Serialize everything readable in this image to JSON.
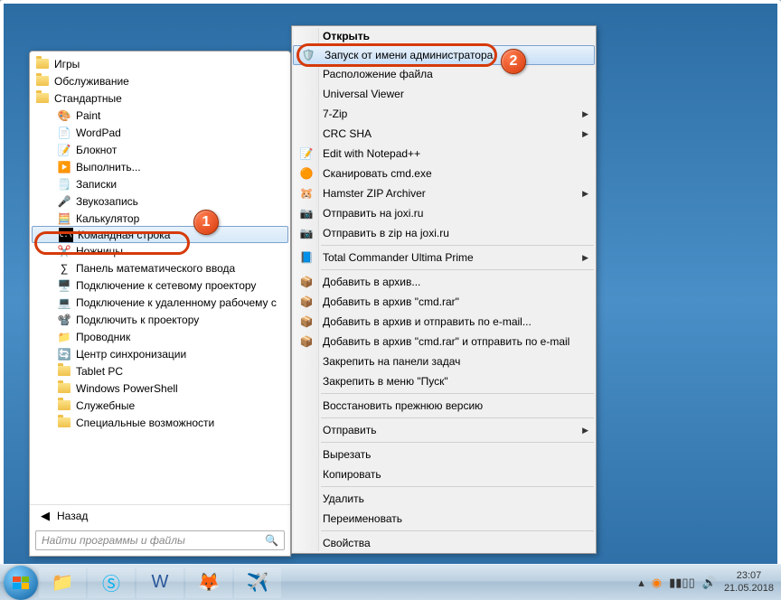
{
  "start_menu": {
    "folders": [
      {
        "label": "Игры",
        "type": "folder"
      },
      {
        "label": "Обслуживание",
        "type": "folder"
      },
      {
        "label": "Стандартные",
        "type": "folder",
        "open": true
      }
    ],
    "items": [
      {
        "label": "Paint",
        "icon": "paint"
      },
      {
        "label": "WordPad",
        "icon": "wordpad"
      },
      {
        "label": "Блокнот",
        "icon": "notepad"
      },
      {
        "label": "Выполнить...",
        "icon": "run"
      },
      {
        "label": "Записки",
        "icon": "notes"
      },
      {
        "label": "Звукозапись",
        "icon": "mic"
      },
      {
        "label": "Калькулятор",
        "icon": "calc"
      },
      {
        "label": "Командная строка",
        "icon": "cmd",
        "selected": true
      },
      {
        "label": "Ножницы",
        "icon": "snip"
      },
      {
        "label": "Панель математического ввода",
        "icon": "math"
      },
      {
        "label": "Подключение к сетевому проектору",
        "icon": "netproj"
      },
      {
        "label": "Подключение к удаленному рабочему с",
        "icon": "rdp"
      },
      {
        "label": "Подключить к проектору",
        "icon": "proj"
      },
      {
        "label": "Проводник",
        "icon": "explorer"
      },
      {
        "label": "Центр синхронизации",
        "icon": "sync"
      },
      {
        "label": "Tablet PC",
        "icon": "folder",
        "type": "folder"
      },
      {
        "label": "Windows PowerShell",
        "icon": "folder",
        "type": "folder"
      },
      {
        "label": "Служебные",
        "icon": "folder",
        "type": "folder"
      },
      {
        "label": "Специальные возможности",
        "icon": "folder",
        "type": "folder"
      }
    ],
    "back": "Назад",
    "search_placeholder": "Найти программы и файлы"
  },
  "context_menu": {
    "groups": [
      [
        {
          "label": "Открыть",
          "bold": true
        },
        {
          "label": "Запуск от имени администратора",
          "icon": "shield",
          "highlight": true
        },
        {
          "label": "Расположение файла"
        },
        {
          "label": "Universal Viewer"
        },
        {
          "label": "7-Zip",
          "submenu": true
        },
        {
          "label": "CRC SHA",
          "submenu": true
        },
        {
          "label": "Edit with Notepad++",
          "icon": "npp"
        },
        {
          "label": "Сканировать cmd.exe",
          "icon": "avast"
        },
        {
          "label": "Hamster ZIP Archiver",
          "icon": "hamster",
          "submenu": true
        },
        {
          "label": "Отправить на joxi.ru",
          "icon": "joxi"
        },
        {
          "label": "Отправить в zip на joxi.ru",
          "icon": "joxi"
        }
      ],
      [
        {
          "label": "Total Commander Ultima Prime",
          "icon": "tc",
          "submenu": true
        }
      ],
      [
        {
          "label": "Добавить в архив...",
          "icon": "rar"
        },
        {
          "label": "Добавить в архив \"cmd.rar\"",
          "icon": "rar"
        },
        {
          "label": "Добавить в архив и отправить по e-mail...",
          "icon": "rar"
        },
        {
          "label": "Добавить в архив \"cmd.rar\" и отправить по e-mail",
          "icon": "rar"
        },
        {
          "label": "Закрепить на панели задач"
        },
        {
          "label": "Закрепить в меню \"Пуск\""
        }
      ],
      [
        {
          "label": "Восстановить прежнюю версию"
        }
      ],
      [
        {
          "label": "Отправить",
          "submenu": true
        }
      ],
      [
        {
          "label": "Вырезать"
        },
        {
          "label": "Копировать"
        }
      ],
      [
        {
          "label": "Удалить"
        },
        {
          "label": "Переименовать"
        }
      ],
      [
        {
          "label": "Свойства"
        }
      ]
    ]
  },
  "badges": {
    "b1": "1",
    "b2": "2"
  },
  "taskbar": {
    "tray": {
      "time": "23:07",
      "date": "21.05.2018"
    }
  }
}
